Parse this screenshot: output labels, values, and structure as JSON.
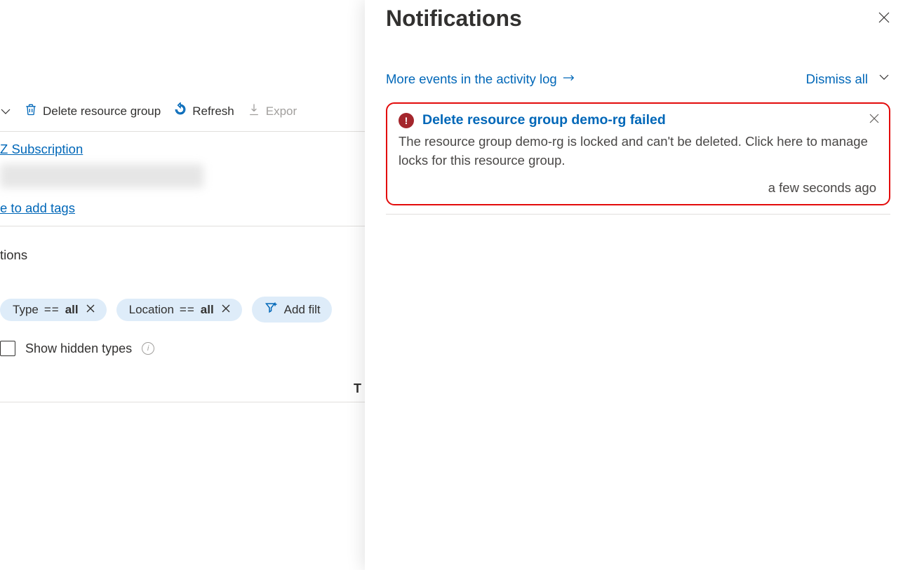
{
  "toolbar": {
    "delete_label": "Delete resource group",
    "refresh_label": "Refresh",
    "export_label": "Expor"
  },
  "main": {
    "subscription_link": "Z Subscription",
    "tags_link": "e to add tags",
    "section_label": "tions",
    "filters": {
      "type": {
        "label": "Type",
        "op": "==",
        "value": "all"
      },
      "location": {
        "label": "Location",
        "op": "==",
        "value": "all"
      },
      "add_filter_label": "Add filt"
    },
    "show_hidden_label": "Show hidden types",
    "column_t": "T"
  },
  "panel": {
    "title": "Notifications",
    "activity_link": "More events in the activity log",
    "dismiss_all": "Dismiss all",
    "notification": {
      "title": "Delete resource group demo-rg failed",
      "body": "The resource group demo-rg is locked and can't be deleted. Click here to manage locks for this resource group.",
      "time": "a few seconds ago"
    }
  }
}
